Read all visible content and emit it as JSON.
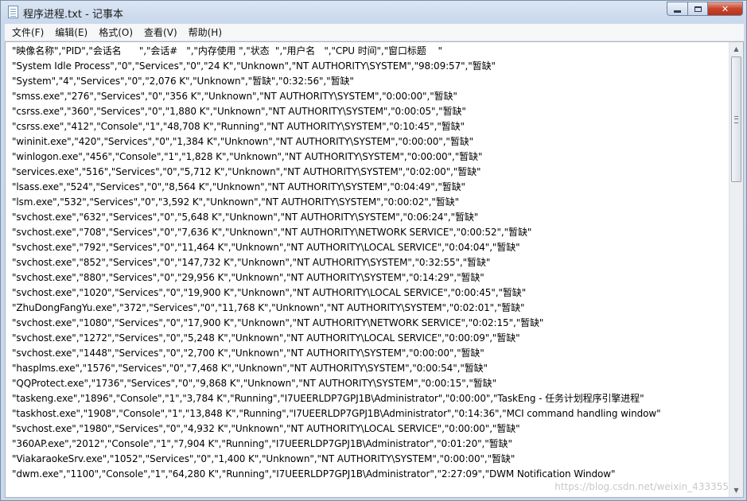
{
  "window": {
    "title": "程序进程.txt - 记事本"
  },
  "menubar": {
    "items": [
      "文件(F)",
      "编辑(E)",
      "格式(O)",
      "查看(V)",
      "帮助(H)"
    ]
  },
  "document": {
    "lines": [
      "\"映像名称\",\"PID\",\"会话名      \",\"会话#   \",\"内存使用 \",\"状态  \",\"用户名   \",\"CPU 时间\",\"窗口标题    \"",
      "\"System Idle Process\",\"0\",\"Services\",\"0\",\"24 K\",\"Unknown\",\"NT AUTHORITY\\SYSTEM\",\"98:09:57\",\"暂缺\"",
      "\"System\",\"4\",\"Services\",\"0\",\"2,076 K\",\"Unknown\",\"暂缺\",\"0:32:56\",\"暂缺\"",
      "\"smss.exe\",\"276\",\"Services\",\"0\",\"356 K\",\"Unknown\",\"NT AUTHORITY\\SYSTEM\",\"0:00:00\",\"暂缺\"",
      "\"csrss.exe\",\"360\",\"Services\",\"0\",\"1,880 K\",\"Unknown\",\"NT AUTHORITY\\SYSTEM\",\"0:00:05\",\"暂缺\"",
      "\"csrss.exe\",\"412\",\"Console\",\"1\",\"48,708 K\",\"Running\",\"NT AUTHORITY\\SYSTEM\",\"0:10:45\",\"暂缺\"",
      "\"wininit.exe\",\"420\",\"Services\",\"0\",\"1,384 K\",\"Unknown\",\"NT AUTHORITY\\SYSTEM\",\"0:00:00\",\"暂缺\"",
      "\"winlogon.exe\",\"456\",\"Console\",\"1\",\"1,828 K\",\"Unknown\",\"NT AUTHORITY\\SYSTEM\",\"0:00:00\",\"暂缺\"",
      "\"services.exe\",\"516\",\"Services\",\"0\",\"5,712 K\",\"Unknown\",\"NT AUTHORITY\\SYSTEM\",\"0:02:00\",\"暂缺\"",
      "\"lsass.exe\",\"524\",\"Services\",\"0\",\"8,564 K\",\"Unknown\",\"NT AUTHORITY\\SYSTEM\",\"0:04:49\",\"暂缺\"",
      "\"lsm.exe\",\"532\",\"Services\",\"0\",\"3,592 K\",\"Unknown\",\"NT AUTHORITY\\SYSTEM\",\"0:00:02\",\"暂缺\"",
      "\"svchost.exe\",\"632\",\"Services\",\"0\",\"5,648 K\",\"Unknown\",\"NT AUTHORITY\\SYSTEM\",\"0:06:24\",\"暂缺\"",
      "\"svchost.exe\",\"708\",\"Services\",\"0\",\"7,636 K\",\"Unknown\",\"NT AUTHORITY\\NETWORK SERVICE\",\"0:00:52\",\"暂缺\"",
      "\"svchost.exe\",\"792\",\"Services\",\"0\",\"11,464 K\",\"Unknown\",\"NT AUTHORITY\\LOCAL SERVICE\",\"0:04:04\",\"暂缺\"",
      "\"svchost.exe\",\"852\",\"Services\",\"0\",\"147,732 K\",\"Unknown\",\"NT AUTHORITY\\SYSTEM\",\"0:32:55\",\"暂缺\"",
      "\"svchost.exe\",\"880\",\"Services\",\"0\",\"29,956 K\",\"Unknown\",\"NT AUTHORITY\\SYSTEM\",\"0:14:29\",\"暂缺\"",
      "\"svchost.exe\",\"1020\",\"Services\",\"0\",\"19,900 K\",\"Unknown\",\"NT AUTHORITY\\LOCAL SERVICE\",\"0:00:45\",\"暂缺\"",
      "\"ZhuDongFangYu.exe\",\"372\",\"Services\",\"0\",\"11,768 K\",\"Unknown\",\"NT AUTHORITY\\SYSTEM\",\"0:02:01\",\"暂缺\"",
      "\"svchost.exe\",\"1080\",\"Services\",\"0\",\"17,900 K\",\"Unknown\",\"NT AUTHORITY\\NETWORK SERVICE\",\"0:02:15\",\"暂缺\"",
      "\"svchost.exe\",\"1272\",\"Services\",\"0\",\"5,248 K\",\"Unknown\",\"NT AUTHORITY\\LOCAL SERVICE\",\"0:00:09\",\"暂缺\"",
      "\"svchost.exe\",\"1448\",\"Services\",\"0\",\"2,700 K\",\"Unknown\",\"NT AUTHORITY\\SYSTEM\",\"0:00:00\",\"暂缺\"",
      "\"hasplms.exe\",\"1576\",\"Services\",\"0\",\"7,468 K\",\"Unknown\",\"NT AUTHORITY\\SYSTEM\",\"0:00:54\",\"暂缺\"",
      "\"QQProtect.exe\",\"1736\",\"Services\",\"0\",\"9,868 K\",\"Unknown\",\"NT AUTHORITY\\SYSTEM\",\"0:00:15\",\"暂缺\"",
      "\"taskeng.exe\",\"1896\",\"Console\",\"1\",\"3,784 K\",\"Running\",\"I7UEERLDP7GPJ1B\\Administrator\",\"0:00:00\",\"TaskEng - 任务计划程序引擎进程\"",
      "\"taskhost.exe\",\"1908\",\"Console\",\"1\",\"13,848 K\",\"Running\",\"I7UEERLDP7GPJ1B\\Administrator\",\"0:14:36\",\"MCI command handling window\"",
      "\"svchost.exe\",\"1980\",\"Services\",\"0\",\"4,932 K\",\"Unknown\",\"NT AUTHORITY\\LOCAL SERVICE\",\"0:00:00\",\"暂缺\"",
      "\"360AP.exe\",\"2012\",\"Console\",\"1\",\"7,904 K\",\"Running\",\"I7UEERLDP7GPJ1B\\Administrator\",\"0:01:20\",\"暂缺\"",
      "\"ViakaraokeSrv.exe\",\"1052\",\"Services\",\"0\",\"1,400 K\",\"Unknown\",\"NT AUTHORITY\\SYSTEM\",\"0:00:00\",\"暂缺\"",
      "\"dwm.exe\",\"1100\",\"Console\",\"1\",\"64,280 K\",\"Running\",\"I7UEERLDP7GPJ1B\\Administrator\",\"2:27:09\",\"DWM Notification Window\""
    ]
  },
  "watermark": "https://blog.csdn.net/weixin_433355",
  "colors": {
    "close_button": "#c7432c",
    "frame": "#cad9ec"
  }
}
